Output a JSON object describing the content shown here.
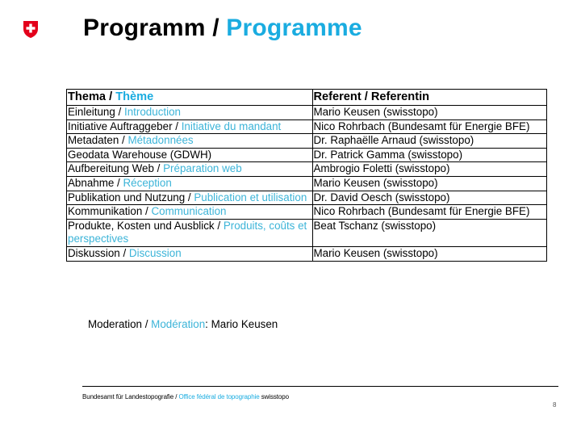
{
  "header": {
    "logo_icon": "swiss-coat-of-arms-icon",
    "title_de": "Programm",
    "title_sep": " / ",
    "title_fr": "Programme"
  },
  "colors": {
    "accent": "#1aace0",
    "logo_red": "#e3001b"
  },
  "table": {
    "headers": {
      "topic_de": "Thema",
      "topic_sep": " / ",
      "topic_fr": "Thème",
      "speaker": "Referent / Referentin"
    },
    "rows": [
      {
        "topic_de": "Einleitung",
        "sep": " / ",
        "topic_fr": "Introduction",
        "speaker": "Mario Keusen (swisstopo)"
      },
      {
        "topic_de": "Initiative Auftraggeber",
        "sep": " / ",
        "topic_fr": "Initiative du mandant",
        "speaker": "Nico Rohrbach (Bundesamt für Energie BFE)"
      },
      {
        "topic_de": "Metadaten",
        "sep": " / ",
        "topic_fr": "Métadonnées",
        "speaker": "Dr. Raphaëlle Arnaud (swisstopo)"
      },
      {
        "topic_de": "Geodata Warehouse (GDWH)",
        "sep": "",
        "topic_fr": "",
        "speaker": "Dr. Patrick Gamma (swisstopo)"
      },
      {
        "topic_de": "Aufbereitung Web",
        "sep": " / ",
        "topic_fr": "Préparation web",
        "speaker": "Ambrogio Foletti (swisstopo)"
      },
      {
        "topic_de": "Abnahme",
        "sep": " / ",
        "topic_fr": "Réception",
        "speaker": "Mario Keusen (swisstopo)"
      },
      {
        "topic_de": "Publikation und Nutzung",
        "sep": " / ",
        "topic_fr": "Publication et utilisation",
        "speaker": "Dr. David Oesch (swisstopo)"
      },
      {
        "topic_de": "Kommunikation",
        "sep": " / ",
        "topic_fr": "Communication",
        "speaker": "Nico Rohrbach (Bundesamt für Energie BFE)"
      },
      {
        "topic_de": "Produkte, Kosten und Ausblick",
        "sep": " / ",
        "topic_fr": "Produits, coûts et perspectives",
        "speaker": "Beat Tschanz (swisstopo)"
      },
      {
        "topic_de": "Diskussion",
        "sep": " / ",
        "topic_fr": "Discussion",
        "speaker": "Mario Keusen (swisstopo)"
      }
    ]
  },
  "moderation": {
    "label_de": "Moderation",
    "sep": " / ",
    "label_fr": "Modération",
    "colon": ": ",
    "name": "Mario Keusen"
  },
  "footer": {
    "org_de": "Bundesamt für Landestopografie",
    "sep": " / ",
    "org_fr": "Office fédéral de topographie",
    "brand": " swisstopo",
    "page_number": "8"
  }
}
